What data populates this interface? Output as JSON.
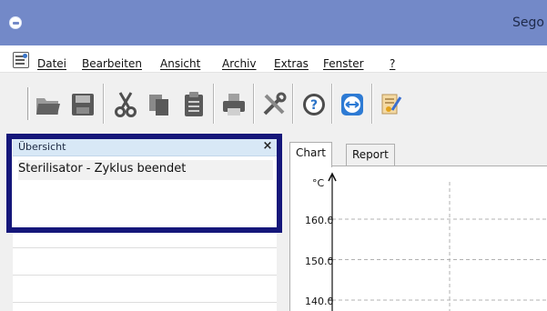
{
  "window": {
    "title": "Sego",
    "app_icon": "segoviewer-app-icon",
    "titlebar_color": "#7389c8"
  },
  "menu": {
    "icon": "document-menu-icon",
    "items": [
      {
        "label": "Datei"
      },
      {
        "label": "Bearbeiten"
      },
      {
        "label": "Ansicht"
      },
      {
        "label": "Archiv"
      },
      {
        "label": "Extras"
      },
      {
        "label": "Fenster"
      },
      {
        "label": "?"
      }
    ]
  },
  "toolbar": {
    "buttons": [
      {
        "icon": "open-folder-icon"
      },
      {
        "icon": "save-icon"
      },
      {
        "icon": "cut-icon"
      },
      {
        "icon": "copy-icon"
      },
      {
        "icon": "paste-icon"
      },
      {
        "icon": "print-icon"
      },
      {
        "icon": "settings-tools-icon"
      },
      {
        "icon": "help-icon"
      },
      {
        "icon": "remote-support-icon"
      },
      {
        "icon": "certificate-icon"
      }
    ]
  },
  "overview": {
    "title": "Übersicht",
    "close": "×",
    "items": [
      {
        "label": "Sterilisator - Zyklus beendet"
      }
    ],
    "highlight_color": "#15177a"
  },
  "tabs": [
    {
      "label": "Chart",
      "active": true
    },
    {
      "label": "Report",
      "active": false
    }
  ],
  "chart": {
    "unit": "°C",
    "ticks": [
      "160.0",
      "150.0",
      "140.0"
    ]
  },
  "chart_data": {
    "type": "line",
    "title": "",
    "xlabel": "",
    "ylabel": "°C",
    "ytick_labels": [
      "160.0",
      "150.0",
      "140.0"
    ],
    "ylim_visible": [
      140.0,
      160.0
    ],
    "grid": true,
    "series": []
  }
}
